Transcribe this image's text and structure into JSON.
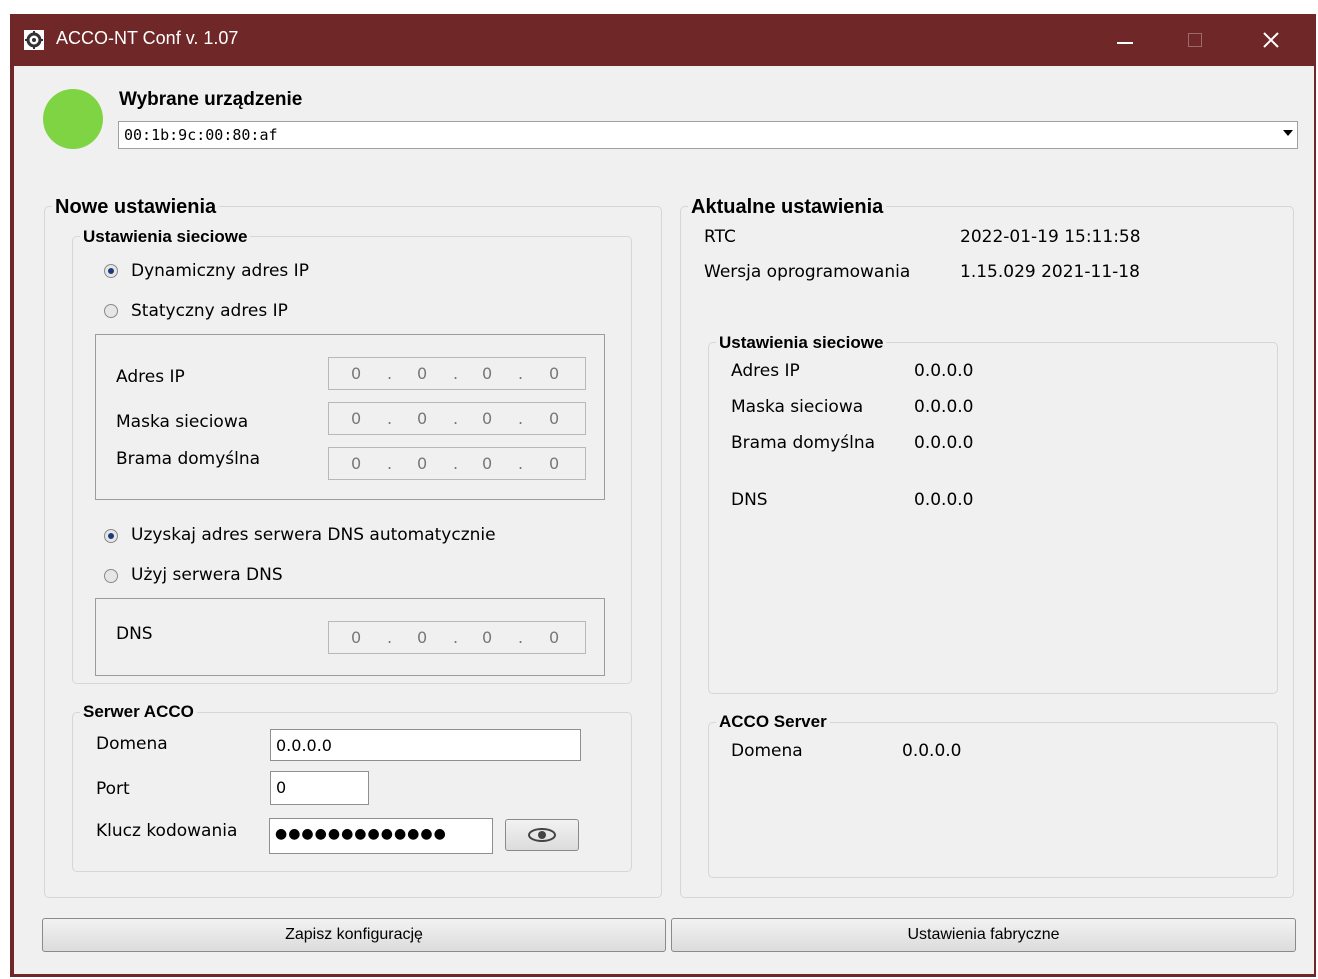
{
  "window": {
    "title": "ACCO-NT Conf v. 1.07"
  },
  "colors": {
    "titlebar": "#6f2727",
    "status_connected": "#7ed443"
  },
  "device": {
    "heading": "Wybrane urządzenie",
    "selected": "00:1b:9c:00:80:af"
  },
  "new_settings": {
    "title": "Nowe ustawienia",
    "network": {
      "title": "Ustawienia sieciowe",
      "radio_dynamic": "Dynamiczny adres IP",
      "radio_static": "Statyczny adres IP",
      "selected_ip_mode": "dynamic",
      "ip_label": "Adres IP",
      "mask_label": "Maska sieciowa",
      "gateway_label": "Brama domyślna",
      "ip": [
        "0",
        "0",
        "0",
        "0"
      ],
      "mask": [
        "0",
        "0",
        "0",
        "0"
      ],
      "gateway": [
        "0",
        "0",
        "0",
        "0"
      ],
      "radio_dns_auto": "Uzyskaj adres serwera DNS automatycznie",
      "radio_dns_manual": "Użyj serwera DNS",
      "selected_dns_mode": "auto",
      "dns_label": "DNS",
      "dns": [
        "0",
        "0",
        "0",
        "0"
      ]
    },
    "server": {
      "title": "Serwer ACCO",
      "domain_label": "Domena",
      "domain_value": "0.0.0.0",
      "port_label": "Port",
      "port_value": "0",
      "key_label": "Klucz kodowania",
      "key_value": "●●●●●●●●●●●●●",
      "show_key_icon": "eye-icon"
    }
  },
  "current_settings": {
    "title": "Aktualne ustawienia",
    "rtc_label": "RTC",
    "rtc_value": "2022-01-19 15:11:58",
    "firmware_label": "Wersja oprogramowania",
    "firmware_value": "1.15.029 2021-11-18",
    "network": {
      "title": "Ustawienia sieciowe",
      "ip_label": "Adres IP",
      "ip_value": "0.0.0.0",
      "mask_label": "Maska sieciowa",
      "mask_value": "0.0.0.0",
      "gateway_label": "Brama domyślna",
      "gateway_value": "0.0.0.0",
      "dns_label": "DNS",
      "dns_value": "0.0.0.0"
    },
    "server": {
      "title": "ACCO Server",
      "domain_label": "Domena",
      "domain_value": "0.0.0.0"
    }
  },
  "buttons": {
    "save": "Zapisz konfigurację",
    "factory": "Ustawienia fabryczne"
  }
}
